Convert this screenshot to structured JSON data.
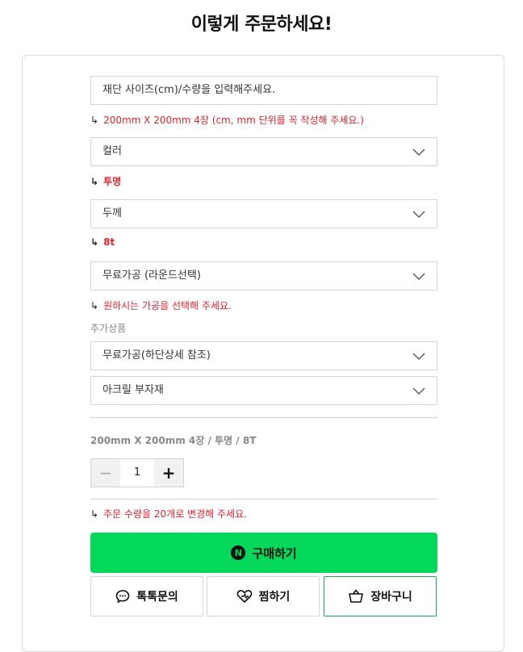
{
  "page_title": "이렇게 주문하세요!",
  "size_input": {
    "placeholder": "재단 사이즈(cm)/수량을 입력해주세요.",
    "value": ""
  },
  "notes": {
    "size": "200mm X 200mm 4장 (cm, mm 단위를 꼭 작성해 주세요.)",
    "color": "투명",
    "thickness": "8t",
    "processing": "원하시는 가공을 선택해 주세요.",
    "quantity": "주문 수량을 20개로 변경해 주세요.",
    "arrow": "↳"
  },
  "selects": {
    "color": "컬러",
    "thickness": "두께",
    "processing": "무료가공 (라운드선택)",
    "extra_processing": "무료가공(하단상세 참조)",
    "accessory": "아크릴 부자재"
  },
  "extra_label": "추가상품",
  "summary": "200mm X 200mm 4장 / 투명 / 8T",
  "quantity": {
    "minus": "−",
    "value": "1",
    "plus": "+"
  },
  "buttons": {
    "buy": "구매하기",
    "npay_mark": "N",
    "talk": "톡톡문의",
    "wish": "찜하기",
    "cart": "장바구니"
  },
  "colors": {
    "accent_green": "#03d85b",
    "note_red": "#e3232f",
    "cart_border": "#22a45a"
  }
}
